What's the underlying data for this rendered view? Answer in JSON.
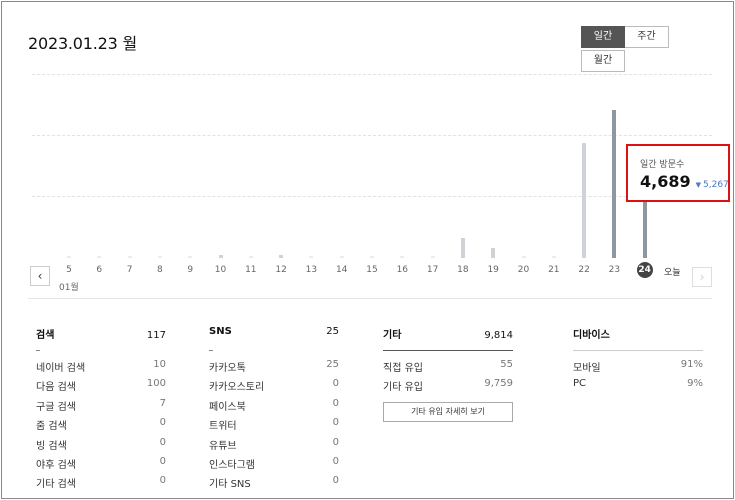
{
  "header": {
    "date": "2023.01.23 월"
  },
  "period_toggle": {
    "daily": "일간",
    "weekly": "주간",
    "dropdown_selected": "월간"
  },
  "chart_data": {
    "type": "bar",
    "categories": [
      "5",
      "6",
      "7",
      "8",
      "9",
      "10",
      "11",
      "12",
      "13",
      "14",
      "15",
      "16",
      "17",
      "18",
      "19",
      "20",
      "21",
      "22",
      "23",
      "24"
    ],
    "month_label": "01월",
    "today_label": "오늘",
    "selected_index": 19,
    "series": [
      {
        "values": [
          0,
          0,
          0,
          0,
          0,
          60,
          0,
          30,
          0,
          0,
          0,
          0,
          0,
          1200,
          600,
          0,
          0,
          7000,
          9000,
          4689
        ]
      }
    ],
    "ylim": [
      0,
      10000
    ]
  },
  "tooltip": {
    "label": "일간 방문수",
    "value": "4,689",
    "compare_arrow": "▼",
    "compare_value": "5,267"
  },
  "stats": {
    "search": {
      "title": "검색",
      "total": "117",
      "rows": [
        {
          "label": "네이버 검색",
          "value": "10"
        },
        {
          "label": "다음 검색",
          "value": "100"
        },
        {
          "label": "구글 검색",
          "value": "7"
        },
        {
          "label": "줌 검색",
          "value": "0"
        },
        {
          "label": "빙 검색",
          "value": "0"
        },
        {
          "label": "야후 검색",
          "value": "0"
        },
        {
          "label": "기타 검색",
          "value": "0"
        }
      ]
    },
    "sns": {
      "title": "SNS",
      "total": "25",
      "rows": [
        {
          "label": "카카오톡",
          "value": "25"
        },
        {
          "label": "카카오스토리",
          "value": "0"
        },
        {
          "label": "페이스북",
          "value": "0"
        },
        {
          "label": "트위터",
          "value": "0"
        },
        {
          "label": "유튜브",
          "value": "0"
        },
        {
          "label": "인스타그램",
          "value": "0"
        },
        {
          "label": "기타 SNS",
          "value": "0"
        }
      ]
    },
    "etc": {
      "title": "기타",
      "total": "9,814",
      "rows": [
        {
          "label": "직접 유입",
          "value": "55"
        },
        {
          "label": "기타 유입",
          "value": "9,759"
        }
      ],
      "detail_button": "기타 유입 자세히 보기"
    },
    "device": {
      "title": "디바이스",
      "rows": [
        {
          "label": "모바일",
          "value": "91%"
        },
        {
          "label": "PC",
          "value": "9%"
        }
      ]
    }
  }
}
